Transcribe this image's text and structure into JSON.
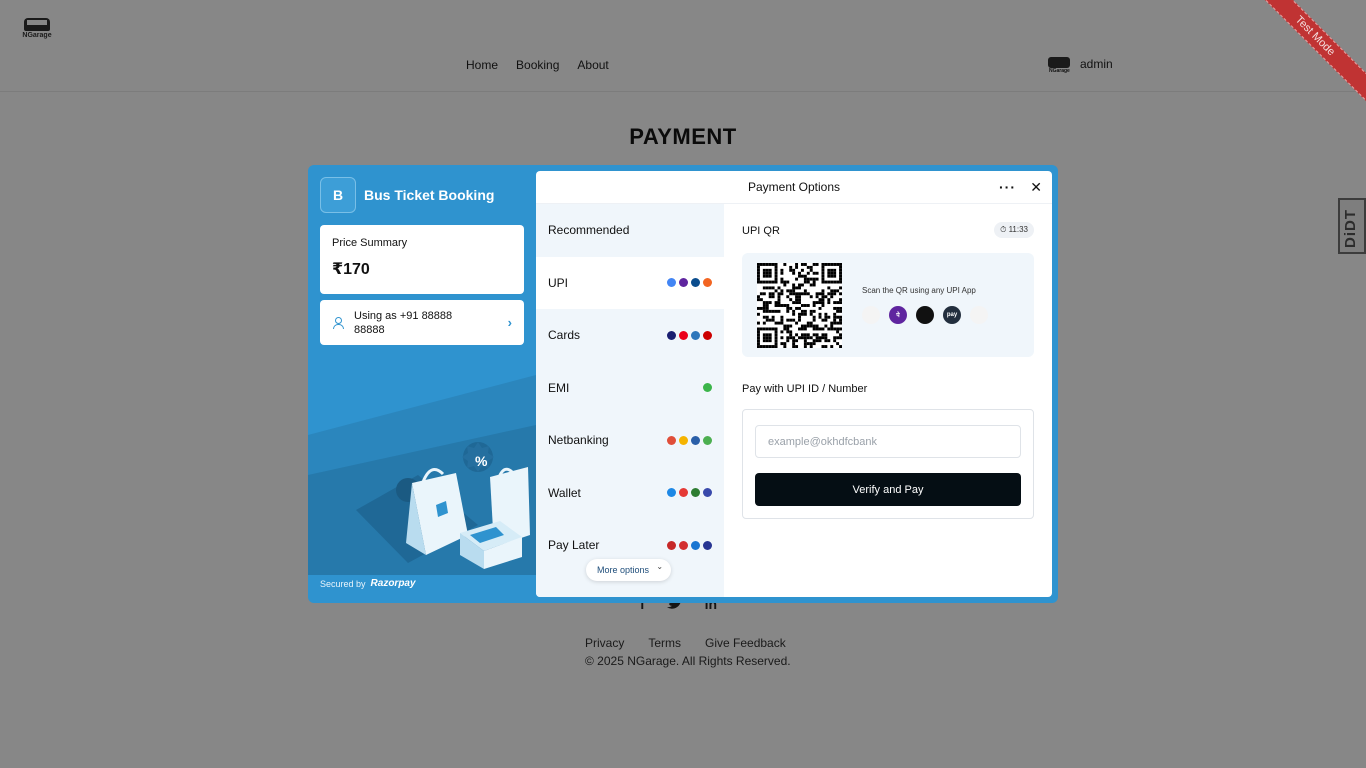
{
  "header": {
    "logo_text": "NGarage",
    "nav": [
      "Home",
      "Booking",
      "About"
    ],
    "username": "admin",
    "avatar_text": "NGarage",
    "ribbon": "Test Mode"
  },
  "page": {
    "title": "PAYMENT",
    "side_tab": "DiDT"
  },
  "footer": {
    "social": [
      "f",
      "t",
      "in"
    ],
    "links": [
      "Privacy",
      "Terms",
      "Give Feedback"
    ],
    "copyright": "© 2025 NGarage. All Rights Reserved."
  },
  "checkout": {
    "merchant_initial": "B",
    "merchant_name": "Bus Ticket Booking",
    "price_label": "Price Summary",
    "price_value": "₹170",
    "contact": "Using as +91 88888 88888",
    "secured_by": "Secured by",
    "brand": "Razorpay",
    "panel_title": "Payment Options",
    "methods": [
      {
        "label": "Recommended"
      },
      {
        "label": "UPI",
        "icons": [
          "#4285f4",
          "#5f259f",
          "#0b4d8e",
          "#f26522"
        ]
      },
      {
        "label": "Cards",
        "icons": [
          "#1a1f71",
          "#eb001b",
          "#2e77bb",
          "#cc0000"
        ]
      },
      {
        "label": "EMI",
        "icons": [
          "#3bb54a"
        ]
      },
      {
        "label": "Netbanking",
        "icons": [
          "#e04e39",
          "#f5b400",
          "#2a5fa8",
          "#4caf50"
        ]
      },
      {
        "label": "Wallet",
        "icons": [
          "#1e88e5",
          "#e53935",
          "#2e7d32",
          "#3949ab"
        ]
      },
      {
        "label": "Pay Later",
        "icons": [
          "#c62828",
          "#d32f2f",
          "#1976d2",
          "#283593"
        ]
      }
    ],
    "more_options": "More options",
    "qr_title": "UPI QR",
    "timer": "11:33",
    "qr_hint": "Scan the QR using any UPI App",
    "qr_apps": [
      {
        "name": "google-pay-icon",
        "color": "#f4f4f4",
        "text": ""
      },
      {
        "name": "phonepe-icon",
        "color": "#5f259f",
        "text": "पे"
      },
      {
        "name": "paytm-icon",
        "color": "#111111",
        "text": ""
      },
      {
        "name": "amazon-pay-icon",
        "color": "#232f3e",
        "text": "pay"
      },
      {
        "name": "bhim-icon",
        "color": "#f4f4f4",
        "text": ""
      }
    ],
    "upi_label": "Pay with UPI ID / Number",
    "upi_placeholder": "example@okhdfcbank",
    "verify_label": "Verify and Pay"
  }
}
